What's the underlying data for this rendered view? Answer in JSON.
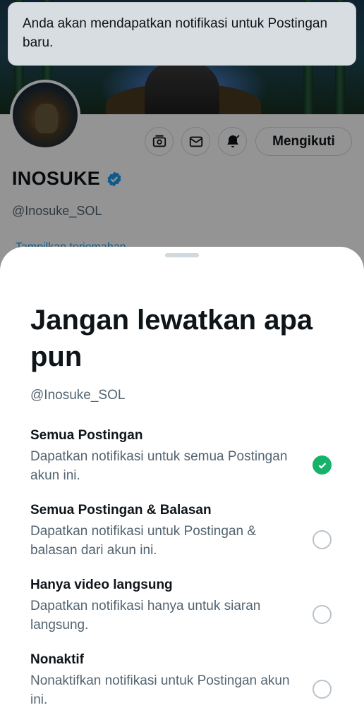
{
  "toast": {
    "message": "Anda akan mendapatkan notifikasi untuk Postingan baru."
  },
  "profile": {
    "name": "INOSUKE",
    "handle": "@Inosuke_SOL",
    "follow_label": "Mengikuti",
    "hidden_link_text": "Tampilkan terjemahan",
    "icons": [
      "subscribe-icon",
      "message-icon",
      "bell-icon",
      "verified-badge-icon"
    ],
    "accent_color": "#1d9bf0"
  },
  "sheet": {
    "title": "Jangan lewatkan apa pun",
    "handle": "@Inosuke_SOL",
    "options": [
      {
        "title": "Semua Postingan",
        "description": "Dapatkan notifikasi untuk semua Postingan akun ini.",
        "selected": true
      },
      {
        "title": "Semua Postingan & Balasan",
        "description": "Dapatkan notifikasi untuk Postingan & balasan dari akun ini.",
        "selected": false
      },
      {
        "title": "Hanya video langsung",
        "description": "Dapatkan notifikasi hanya untuk siaran langsung.",
        "selected": false
      },
      {
        "title": "Nonaktif",
        "description": "Nonaktifkan notifikasi untuk Postingan akun ini.",
        "selected": false
      }
    ],
    "selected_color": "#17b26a"
  }
}
